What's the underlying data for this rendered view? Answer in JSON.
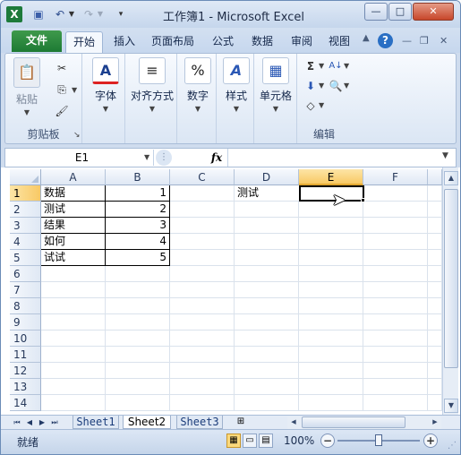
{
  "window": {
    "title": "工作簿1 - Microsoft Excel",
    "app_icon": "X",
    "minimize": "—",
    "maximize": "□",
    "close": "✕"
  },
  "qat": {
    "save": "▣",
    "undo": "↶",
    "undo_drop": "▼",
    "redo": "↷",
    "redo_drop": "▼",
    "customize": "▾"
  },
  "tabs": [
    {
      "label": "文件"
    },
    {
      "label": "开始"
    },
    {
      "label": "插入"
    },
    {
      "label": "页面布局"
    },
    {
      "label": "公式"
    },
    {
      "label": "数据"
    },
    {
      "label": "审阅"
    },
    {
      "label": "视图"
    }
  ],
  "help": "?",
  "doc_controls": {
    "collapse": "▲",
    "minimize": "—",
    "restore": "❐",
    "close": "✕"
  },
  "ribbon": {
    "clipboard": {
      "label": "剪贴板",
      "paste": "粘贴",
      "cut": "✂",
      "copy": "⎘",
      "format_painter": "🖌",
      "launcher": "↘"
    },
    "font": {
      "label": "字体",
      "icon": "A"
    },
    "alignment": {
      "label": "对齐方式",
      "icon": "≡"
    },
    "number": {
      "label": "数字",
      "icon": "%"
    },
    "styles": {
      "label": "样式",
      "icon": "A"
    },
    "cells": {
      "label": "单元格",
      "icon": "▦"
    },
    "editing": {
      "label": "编辑",
      "autosum": "Σ",
      "sort": "A↓",
      "fill": "⬇",
      "find": "🔍",
      "clear": "◇"
    }
  },
  "formula_bar": {
    "name_box": "E1",
    "fx": "fx",
    "value": ""
  },
  "grid": {
    "columns": [
      "A",
      "B",
      "C",
      "D",
      "E",
      "F"
    ],
    "selected_column": "E",
    "rows": [
      "1",
      "2",
      "3",
      "4",
      "5",
      "6",
      "7",
      "8",
      "9",
      "10",
      "11",
      "12",
      "13",
      "14"
    ],
    "selected_row": "1",
    "cells": {
      "A1": "数据",
      "B1": "1",
      "A2": "测试",
      "B2": "2",
      "A3": "结果",
      "B3": "3",
      "A4": "如何",
      "B4": "4",
      "A5": "试试",
      "B5": "5",
      "D1": "测试"
    }
  },
  "sheets": {
    "tabs": [
      "Sheet1",
      "Sheet2",
      "Sheet3"
    ],
    "active": "Sheet2",
    "nav": [
      "⏮",
      "◀",
      "▶",
      "⏭"
    ]
  },
  "status": {
    "ready": "就绪",
    "zoom": "100%",
    "zoom_out": "−",
    "zoom_in": "+"
  }
}
